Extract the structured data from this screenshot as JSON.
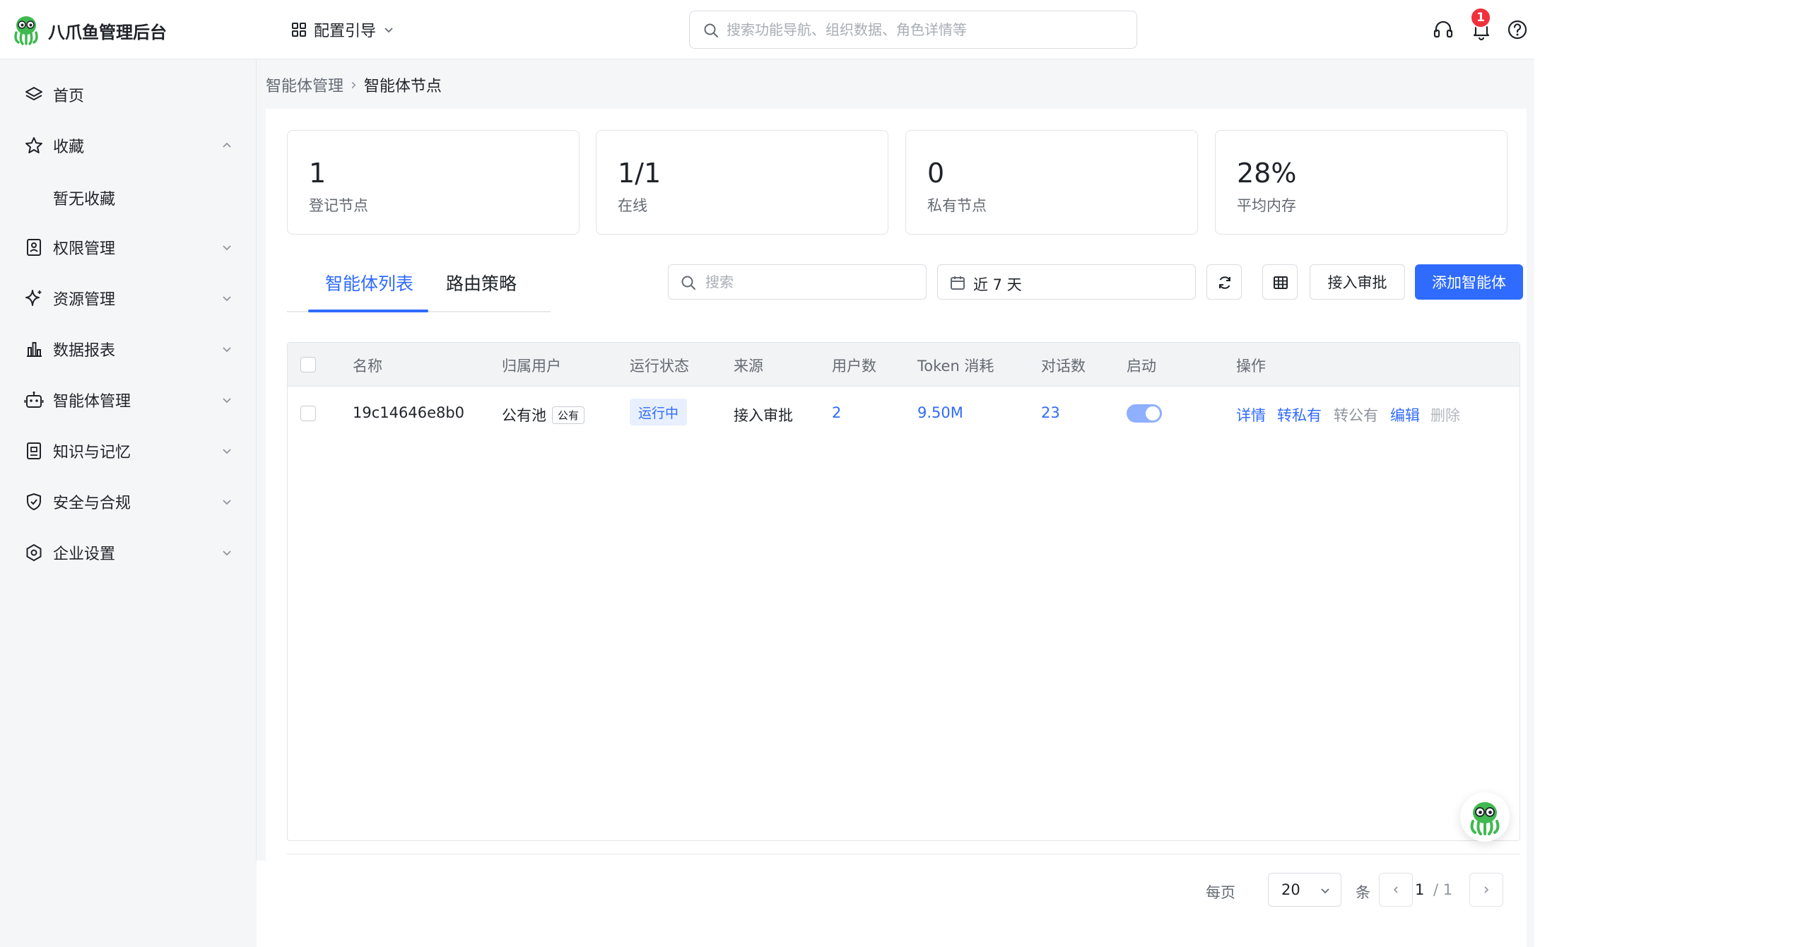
{
  "header": {
    "brand": "八爪鱼管理后台",
    "guide_label": "配置引导",
    "search_placeholder": "搜索功能导航、组织数据、角色详情等",
    "notification_count": "1"
  },
  "sidebar": {
    "items": [
      {
        "label": "首页",
        "icon": "layers-icon"
      },
      {
        "label": "收藏",
        "icon": "star-icon",
        "expanded": true
      },
      {
        "label": "权限管理",
        "icon": "id-card-icon"
      },
      {
        "label": "资源管理",
        "icon": "sparkle-icon"
      },
      {
        "label": "数据报表",
        "icon": "bar-chart-icon"
      },
      {
        "label": "智能体管理",
        "icon": "robot-icon"
      },
      {
        "label": "知识与记忆",
        "icon": "book-icon"
      },
      {
        "label": "安全与合规",
        "icon": "shield-check-icon"
      },
      {
        "label": "企业设置",
        "icon": "hexagon-gear-icon"
      }
    ],
    "favorites_empty": "暂无收藏"
  },
  "breadcrumb": {
    "parent": "智能体管理",
    "separator": "›",
    "current": "智能体节点"
  },
  "stats": [
    {
      "value": "1",
      "label": "登记节点"
    },
    {
      "value": "1/1",
      "label": "在线"
    },
    {
      "value": "0",
      "label": "私有节点"
    },
    {
      "value": "28%",
      "label": "平均内存"
    }
  ],
  "tabs": [
    {
      "label": "智能体列表",
      "active": true
    },
    {
      "label": "路由策略",
      "active": false
    }
  ],
  "toolbar": {
    "search_placeholder": "搜索",
    "date_range": "近 7 天",
    "approve_label": "接入审批",
    "add_label": "添加智能体"
  },
  "table": {
    "columns": [
      "名称",
      "归属用户",
      "运行状态",
      "来源",
      "用户数",
      "Token 消耗",
      "对话数",
      "启动",
      "操作"
    ],
    "rows": [
      {
        "name": "19c14646e8b0",
        "owner": "公有池",
        "owner_tag": "公有",
        "status": "运行中",
        "source": "接入审批",
        "users": "2",
        "tokens": "9.50M",
        "dialogs": "23",
        "enabled": true,
        "actions": [
          "详情",
          "转私有",
          "转公有",
          "编辑",
          "删除"
        ]
      }
    ]
  },
  "pagination": {
    "per_page_label": "每页",
    "page_size": "20",
    "unit_label": "条",
    "current_page": "1",
    "total_pages": "/ 1"
  },
  "colors": {
    "accent": "#2f6bff",
    "badge": "#f0303b",
    "sidebar_bg": "#f5f6f8"
  }
}
